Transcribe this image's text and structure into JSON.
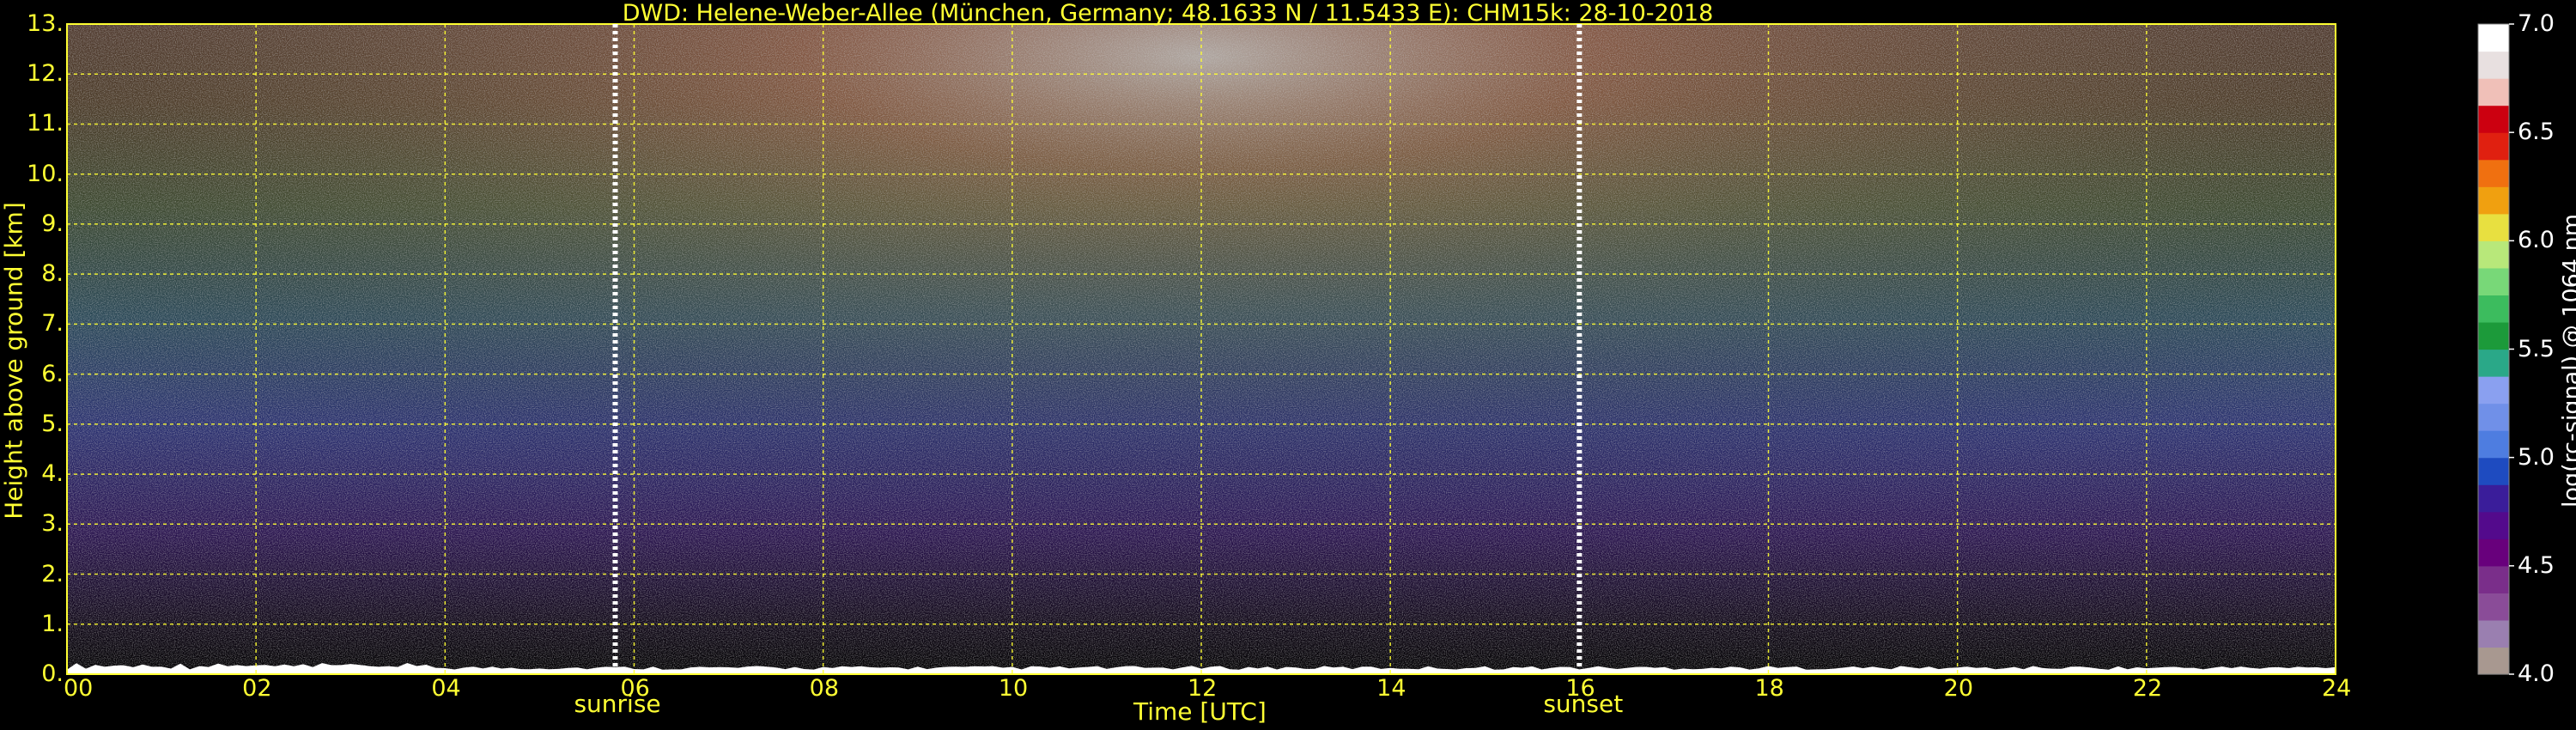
{
  "chart_data": {
    "type": "heatmap",
    "title": "DWD: Helene-Weber-Allee (München, Germany; 48.1633 N / 11.5433 E):    CHM15k: 28-10-2018",
    "xlabel": "Time [UTC]",
    "ylabel": "Height above ground [km]",
    "x_ticks": [
      "00",
      "02",
      "04",
      "06",
      "08",
      "10",
      "12",
      "14",
      "16",
      "18",
      "20",
      "22",
      "24"
    ],
    "xlim": [
      0,
      24
    ],
    "y_ticks": [
      "0.",
      "1.",
      "2.",
      "3.",
      "4.",
      "5.",
      "6.",
      "7.",
      "8.",
      "9.",
      "10.",
      "11.",
      "12.",
      "13."
    ],
    "ylim": [
      0,
      13
    ],
    "grid": true,
    "sunrise": {
      "label": "sunrise",
      "time_utc": 5.8
    },
    "sunset": {
      "label": "sunset",
      "time_utc": 16.0
    },
    "colorbar": {
      "label": "log(rc-signal) @ 1064 nm",
      "ticks": [
        "4.0",
        "4.5",
        "5.0",
        "5.5",
        "6.0",
        "6.5",
        "7.0"
      ],
      "range": [
        4.0,
        7.0
      ],
      "colors": [
        "#a89890",
        "#9a7fb0",
        "#8a4c98",
        "#7a2e8a",
        "#68007c",
        "#530a8c",
        "#3a1d9a",
        "#1e4bc0",
        "#4e7de0",
        "#7090e8",
        "#8aa0f0",
        "#2aa888",
        "#1c9a3a",
        "#3cbc5e",
        "#78d878",
        "#b8e87a",
        "#e8e040",
        "#f0a010",
        "#f07010",
        "#e02010",
        "#cc0010",
        "#f0c0b8",
        "#e8e0e0",
        "#ffffff"
      ]
    },
    "layers": [
      {
        "height_km": [
          0.0,
          1.0
        ],
        "signal": 4.1
      },
      {
        "height_km": [
          1.0,
          3.0
        ],
        "signal": 4.6
      },
      {
        "height_km": [
          3.0,
          5.5
        ],
        "signal": 5.0
      },
      {
        "height_km": [
          5.5,
          8.5
        ],
        "signal": 5.5
      },
      {
        "height_km": [
          8.5,
          11.0
        ],
        "signal": 5.8
      },
      {
        "height_km": [
          11.0,
          13.0
        ],
        "signal": 6.0
      }
    ],
    "daytime_enhancement": {
      "peak_time_utc": 10.5,
      "peak_signal_increase": 0.6
    },
    "boundary_layer_height_km": 0.15
  },
  "colors": {
    "axis": "#ffff33",
    "grid": "#ffff33",
    "background": "#000000"
  }
}
